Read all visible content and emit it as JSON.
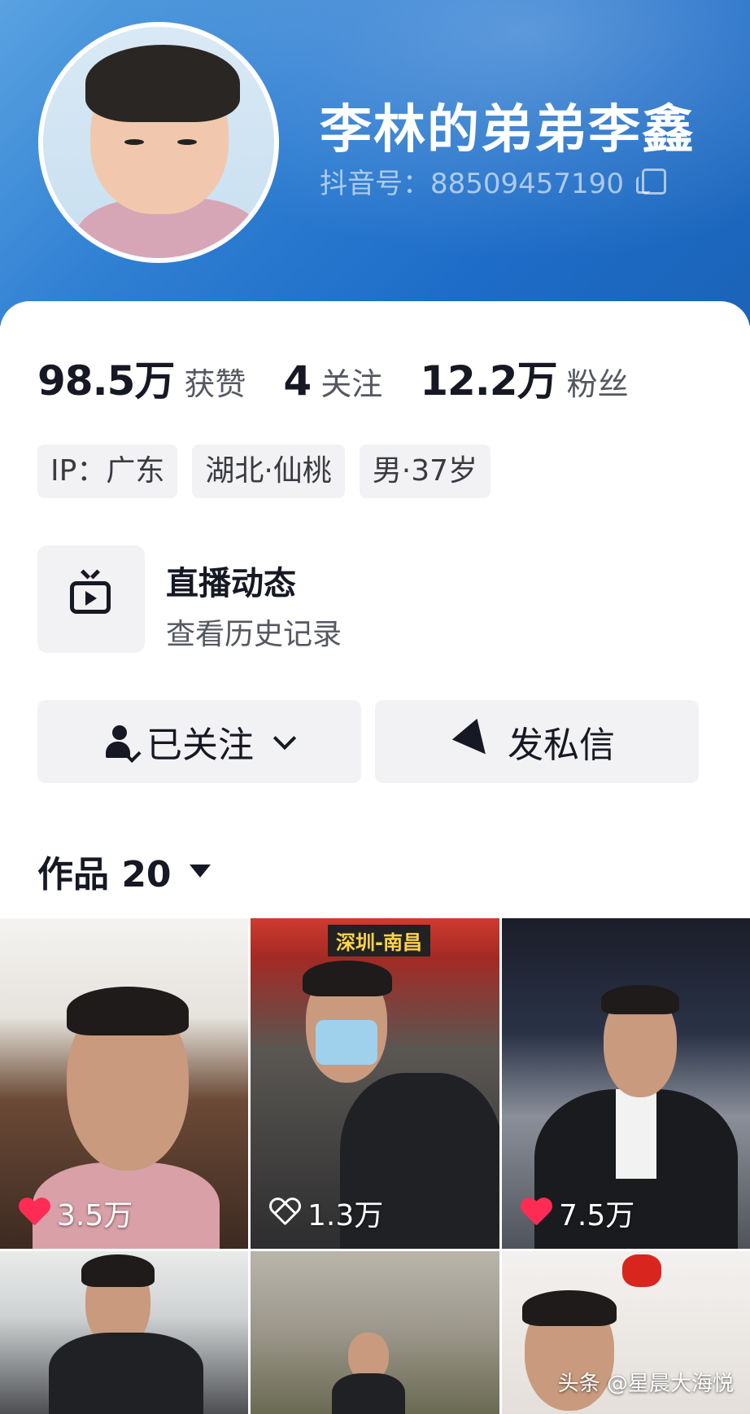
{
  "profile": {
    "name": "李林的弟弟李鑫",
    "douyin_id": "抖音号：88509457190"
  },
  "stats": [
    {
      "value": "98.5万",
      "label": "获赞"
    },
    {
      "value": "4",
      "label": "关注"
    },
    {
      "value": "12.2万",
      "label": "粉丝"
    }
  ],
  "tags": [
    "IP：广东",
    "湖北·仙桃",
    "男·37岁"
  ],
  "live": {
    "title": "直播动态",
    "subtitle": "查看历史记录",
    "icon": "tv-icon"
  },
  "buttons": {
    "follow": "已关注",
    "message": "发私信"
  },
  "works": {
    "label": "作品 20"
  },
  "videos": [
    {
      "likes": "3.5万",
      "liked": true,
      "caption": ""
    },
    {
      "likes": "1.3万",
      "liked": false,
      "caption": "深圳-南昌"
    },
    {
      "likes": "7.5万",
      "liked": true,
      "caption": ""
    },
    {
      "likes": "",
      "liked": false,
      "caption": ""
    },
    {
      "likes": "",
      "liked": false,
      "caption": ""
    },
    {
      "likes": "",
      "liked": false,
      "caption": ""
    }
  ],
  "watermark": "头条 @星晨大海悦",
  "colors": {
    "header_blue": "#1d6cc7",
    "like_red": "#fe2c55"
  }
}
